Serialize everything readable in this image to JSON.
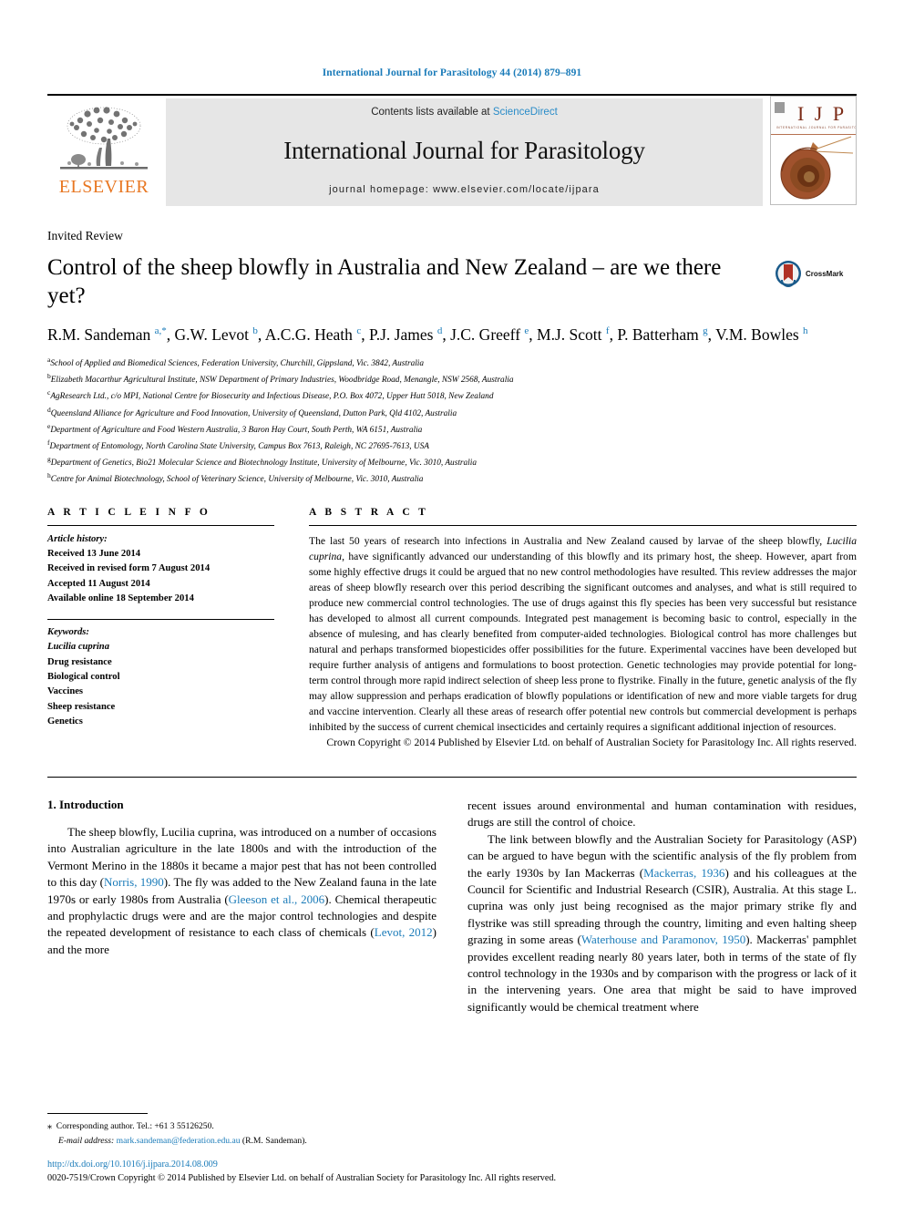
{
  "running_head": "International Journal for Parasitology 44 (2014) 879–891",
  "masthead": {
    "publisher": "ELSEVIER",
    "contents_prefix": "Contents lists available at ",
    "contents_link": "ScienceDirect",
    "journal_name": "International Journal for Parasitology",
    "homepage": "journal homepage: www.elsevier.com/locate/ijpara",
    "cover_title": "I J P",
    "cover_subtitle": "INTERNATIONAL JOURNAL FOR PARASITOLOGY"
  },
  "article": {
    "type": "Invited Review",
    "title": "Control of the sheep blowfly in Australia and New Zealand – are we there yet?",
    "crossmark_label": "CrossMark",
    "authors_html": "R.M. Sandeman <sup>a,*</sup>, G.W. Levot <sup>b</sup>, A.C.G. Heath <sup>c</sup>, P.J. James <sup>d</sup>, J.C. Greeff <sup>e</sup>, M.J. Scott <sup>f</sup>, P. Batterham <sup>g</sup>, V.M. Bowles <sup>h</sup>",
    "affiliations": [
      {
        "mark": "a",
        "text": "School of Applied and Biomedical Sciences, Federation University, Churchill, Gippsland, Vic. 3842, Australia"
      },
      {
        "mark": "b",
        "text": "Elizabeth Macarthur Agricultural Institute, NSW Department of Primary Industries, Woodbridge Road, Menangle, NSW 2568, Australia"
      },
      {
        "mark": "c",
        "text": "AgResearch Ltd., c/o MPI, National Centre for Biosecurity and Infectious Disease, P.O. Box 4072, Upper Hutt 5018, New Zealand"
      },
      {
        "mark": "d",
        "text": "Queensland Alliance for Agriculture and Food Innovation, University of Queensland, Dutton Park, Qld 4102, Australia"
      },
      {
        "mark": "e",
        "text": "Department of Agriculture and Food Western Australia, 3 Baron Hay Court, South Perth, WA 6151, Australia"
      },
      {
        "mark": "f",
        "text": "Department of Entomology, North Carolina State University, Campus Box 7613, Raleigh, NC 27695-7613, USA"
      },
      {
        "mark": "g",
        "text": "Department of Genetics, Bio21 Molecular Science and Biotechnology Institute, University of Melbourne, Vic. 3010, Australia"
      },
      {
        "mark": "h",
        "text": "Centre for Animal Biotechnology, School of Veterinary Science, University of Melbourne, Vic. 3010, Australia"
      }
    ]
  },
  "article_info": {
    "heading": "A R T I C L E   I N F O",
    "history_label": "Article history:",
    "history": [
      "Received 13 June 2014",
      "Received in revised form 7 August 2014",
      "Accepted 11 August 2014",
      "Available online 18 September 2014"
    ],
    "keywords_label": "Keywords:",
    "keywords": [
      "Lucilia cuprina",
      "Drug resistance",
      "Biological control",
      "Vaccines",
      "Sheep resistance",
      "Genetics"
    ]
  },
  "abstract": {
    "heading": "A B S T R A C T",
    "text_html": "The last 50 years of research into infections in Australia and New Zealand caused by larvae of the sheep blowfly, <span class=\"sp\">Lucilia cuprina</span>, have significantly advanced our understanding of this blowfly and its primary host, the sheep. However, apart from some highly effective drugs it could be argued that no new control methodologies have resulted. This review addresses the major areas of sheep blowfly research over this period describing the significant outcomes and analyses, and what is still required to produce new commercial control technologies. The use of drugs against this fly species has been very successful but resistance has developed to almost all current compounds. Integrated pest management is becoming basic to control, especially in the absence of mulesing, and has clearly benefited from computer-aided technologies. Biological control has more challenges but natural and perhaps transformed biopesticides offer possibilities for the future. Experimental vaccines have been developed but require further analysis of antigens and formulations to boost protection. Genetic technologies may provide potential for long-term control through more rapid indirect selection of sheep less prone to flystrike. Finally in the future, genetic analysis of the fly may allow suppression and perhaps eradication of blowfly populations or identification of new and more viable targets for drug and vaccine intervention. Clearly all these areas of research offer potential new controls but commercial development is perhaps inhibited by the success of current chemical insecticides and certainly requires a significant additional injection of resources.",
    "copyright": "Crown Copyright © 2014 Published by Elsevier Ltd. on behalf of Australian Society for Parasitology Inc. All rights reserved."
  },
  "body": {
    "section_heading": "1. Introduction",
    "left_para_html": "The sheep blowfly, <span class=\"sp\">Lucilia cuprina</span>, was introduced on a number of occasions into Australian agriculture in the late 1800s and with the introduction of the Vermont Merino in the 1880s it became a major pest that has not been controlled to this day (<span class=\"ref\">Norris, 1990</span>). The fly was added to the New Zealand fauna in the late 1970s or early 1980s from Australia (<span class=\"ref\">Gleeson et al., 2006</span>). Chemical therapeutic and prophylactic drugs were and are the major control technologies and despite the repeated development of resistance to each class of chemicals (<span class=\"ref\">Levot, 2012</span>) and the more",
    "right_para1_html": "recent issues around environmental and human contamination with residues, drugs are still the control of choice.",
    "right_para2_html": "The link between blowfly and the Australian Society for Parasitology (ASP) can be argued to have begun with the scientific analysis of the fly problem from the early 1930s by Ian Mackerras (<span class=\"ref\">Mackerras, 1936</span>) and his colleagues at the Council for Scientific and Industrial Research (CSIR), Australia. At this stage <span class=\"sp\">L. cuprina</span> was only just being recognised as the major primary strike fly and flystrike was still spreading through the country, limiting and even halting sheep grazing in some areas (<span class=\"ref\">Waterhouse and Paramonov, 1950</span>). Mackerras' pamphlet provides excellent reading nearly 80 years later, both in terms of the state of fly control technology in the 1930s and by comparison with the progress or lack of it in the intervening years. One area that might be said to have improved significantly would be chemical treatment where"
  },
  "footnote": {
    "corresponding_html": "<span class=\"star\">⁎</span>&nbsp; Corresponding author. Tel.: +61 3 55126250.",
    "email_html": "<span class=\"em\">E-mail address:</span> <span class=\"ref\">mark.sandeman@federation.edu.au</span> (R.M. Sandeman)."
  },
  "footer": {
    "doi": "http://dx.doi.org/10.1016/j.ijpara.2014.08.009",
    "issn_line": "0020-7519/Crown Copyright © 2014 Published by Elsevier Ltd. on behalf of Australian Society for Parasitology Inc. All rights reserved."
  },
  "colors": {
    "link_blue": "#1a7bb9",
    "sciencedirect_blue": "#2a8cc8",
    "elsevier_orange": "#e87722",
    "band_grey": "#e6e6e6"
  }
}
